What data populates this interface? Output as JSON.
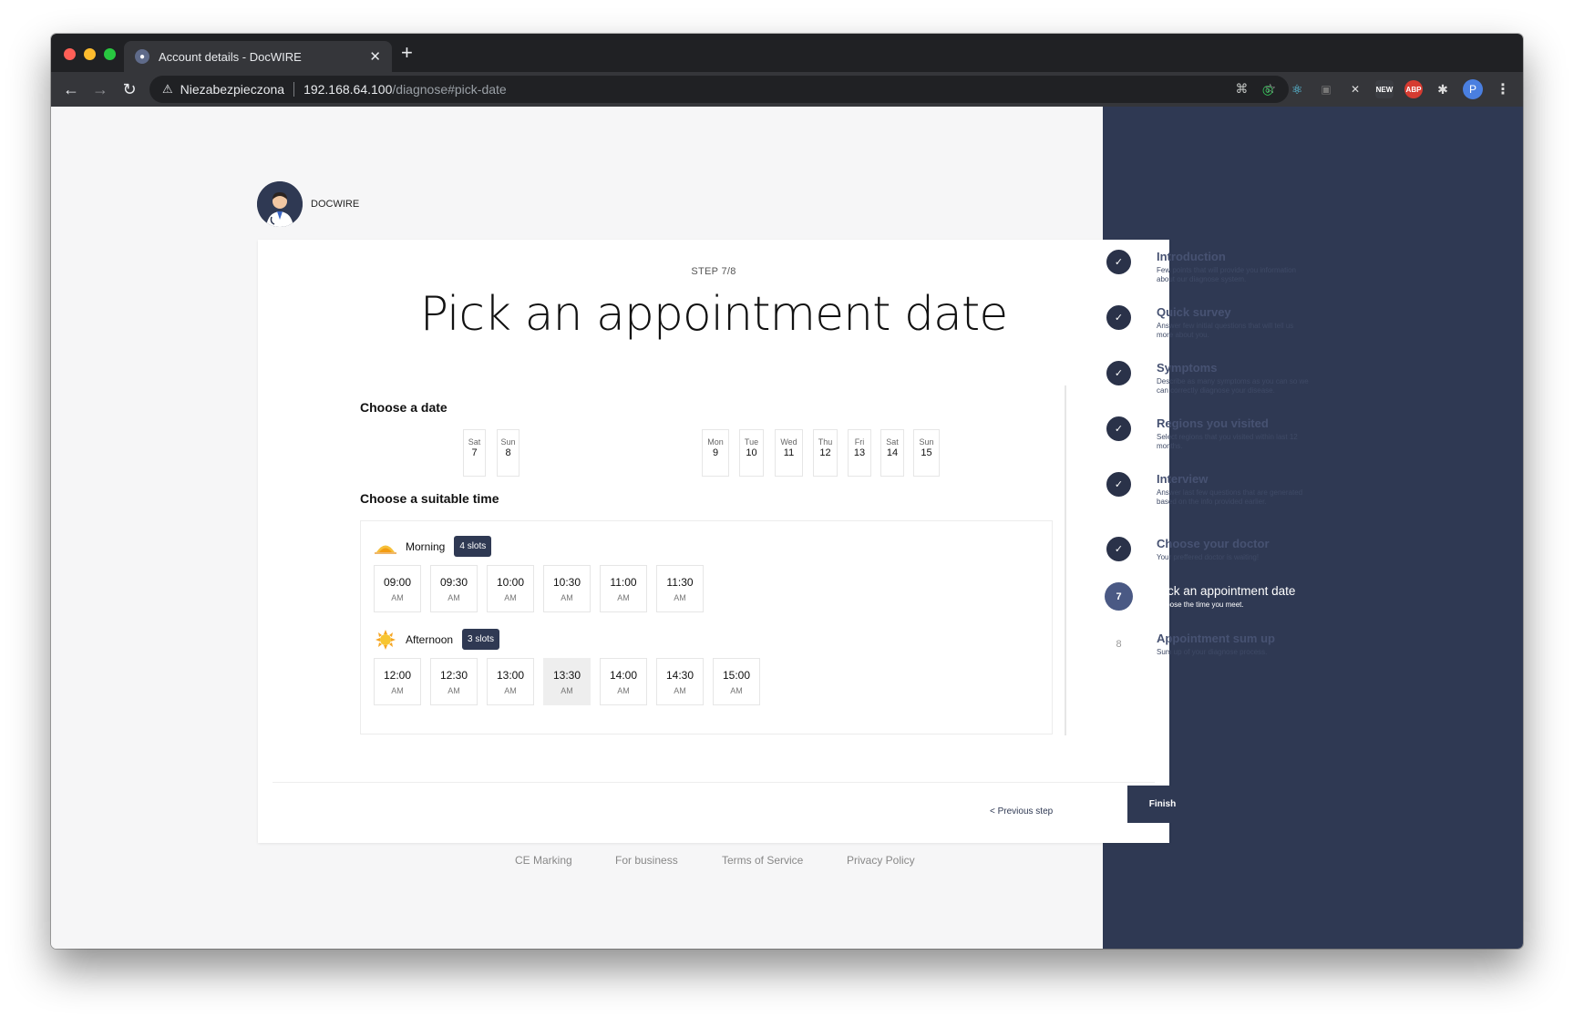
{
  "browser": {
    "tab_title": "Account details - DocWIRE",
    "new_tab": "+",
    "tab_close": "✕",
    "insecure_label": "Niezabezpieczona",
    "url_host": "192.168.64.100",
    "url_path": "/diagnose#pick-date",
    "profile_initial": "P",
    "ext_labels": [
      "NEW",
      "ABP"
    ]
  },
  "brand": {
    "name": "DOCWIRE"
  },
  "step": {
    "label": "STEP 7/8",
    "title": "Pick an appointment date"
  },
  "dates": {
    "heading": "Choose a date",
    "days": [
      {
        "name": "Sat",
        "num": "7"
      },
      {
        "name": "Sun",
        "num": "8"
      },
      {
        "name": "Mon",
        "num": "9"
      },
      {
        "name": "Tue",
        "num": "10"
      },
      {
        "name": "Wed",
        "num": "11"
      },
      {
        "name": "Thu",
        "num": "12"
      },
      {
        "name": "Fri",
        "num": "13"
      },
      {
        "name": "Sat",
        "num": "14"
      },
      {
        "name": "Sun",
        "num": "15"
      }
    ]
  },
  "times": {
    "heading": "Choose a suitable time",
    "morning": {
      "label": "Morning",
      "badge": "4 slots",
      "slots": [
        {
          "time": "09:00",
          "meridiem": "AM"
        },
        {
          "time": "09:30",
          "meridiem": "AM"
        },
        {
          "time": "10:00",
          "meridiem": "AM"
        },
        {
          "time": "10:30",
          "meridiem": "AM"
        },
        {
          "time": "11:00",
          "meridiem": "AM"
        },
        {
          "time": "11:30",
          "meridiem": "AM"
        }
      ]
    },
    "afternoon": {
      "label": "Afternoon",
      "badge": "3 slots",
      "slots": [
        {
          "time": "12:00",
          "meridiem": "AM"
        },
        {
          "time": "12:30",
          "meridiem": "AM"
        },
        {
          "time": "13:00",
          "meridiem": "AM"
        },
        {
          "time": "13:30",
          "meridiem": "AM",
          "selected": true
        },
        {
          "time": "14:00",
          "meridiem": "AM"
        },
        {
          "time": "14:30",
          "meridiem": "AM"
        },
        {
          "time": "15:00",
          "meridiem": "AM"
        }
      ]
    }
  },
  "actions": {
    "previous": "< Previous step",
    "finish": "Finish"
  },
  "footer": {
    "links": [
      "CE Marking",
      "For business",
      "Terms of Service",
      "Privacy Policy"
    ]
  },
  "steps": [
    {
      "state": "done",
      "marker": "✓",
      "title": "Introduction",
      "desc": "Few points that will provide you information about our diagnose system."
    },
    {
      "state": "done",
      "marker": "✓",
      "title": "Quick survey",
      "desc": "Answer few initial questions that will tell us more about you."
    },
    {
      "state": "done",
      "marker": "✓",
      "title": "Symptoms",
      "desc": "Describe as many symptoms as you can so we can correctly diagnose your disease."
    },
    {
      "state": "done",
      "marker": "✓",
      "title": "Regions you visited",
      "desc": "Select regions that you visited within last 12 months."
    },
    {
      "state": "done",
      "marker": "✓",
      "title": "Interview",
      "desc": "Answer last few questions that are generated based on the info provided earlier."
    },
    {
      "state": "done",
      "marker": "✓",
      "title": "Choose your doctor",
      "desc": "Your preffered doctor is waiting!"
    },
    {
      "state": "active",
      "marker": "7",
      "title": "Pick an appointment date",
      "desc": "Choose the time you meet."
    },
    {
      "state": "pending",
      "marker": "8",
      "title": "Appointment sum up",
      "desc": "Sum up of your diagnose process."
    }
  ],
  "colors": {
    "sidebar": "#2f3953",
    "accent": "#2f3953",
    "page_bg": "#f6f6f7"
  }
}
